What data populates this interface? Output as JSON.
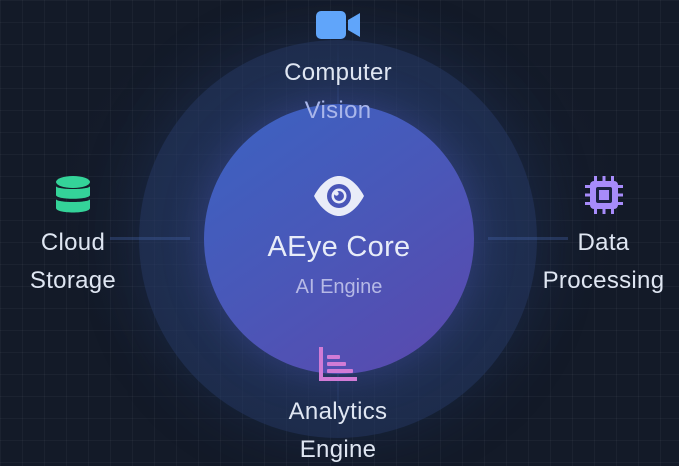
{
  "core": {
    "title": "AEye Core",
    "subtitle": "AI Engine",
    "icon": "eye-icon"
  },
  "nodes": {
    "top": {
      "line1": "Computer",
      "line2": "Vision",
      "icon": "video-camera-icon",
      "color": "#60a5fa"
    },
    "left": {
      "line1": "Cloud",
      "line2": "Storage",
      "icon": "database-icon",
      "color": "#34d399"
    },
    "right": {
      "line1": "Data",
      "line2": "Processing",
      "icon": "cpu-chip-icon",
      "color": "#a78bfa"
    },
    "bottom": {
      "line1": "Analytics",
      "line2": "Engine",
      "icon": "bar-chart-icon",
      "color": "#d17bd6"
    }
  }
}
